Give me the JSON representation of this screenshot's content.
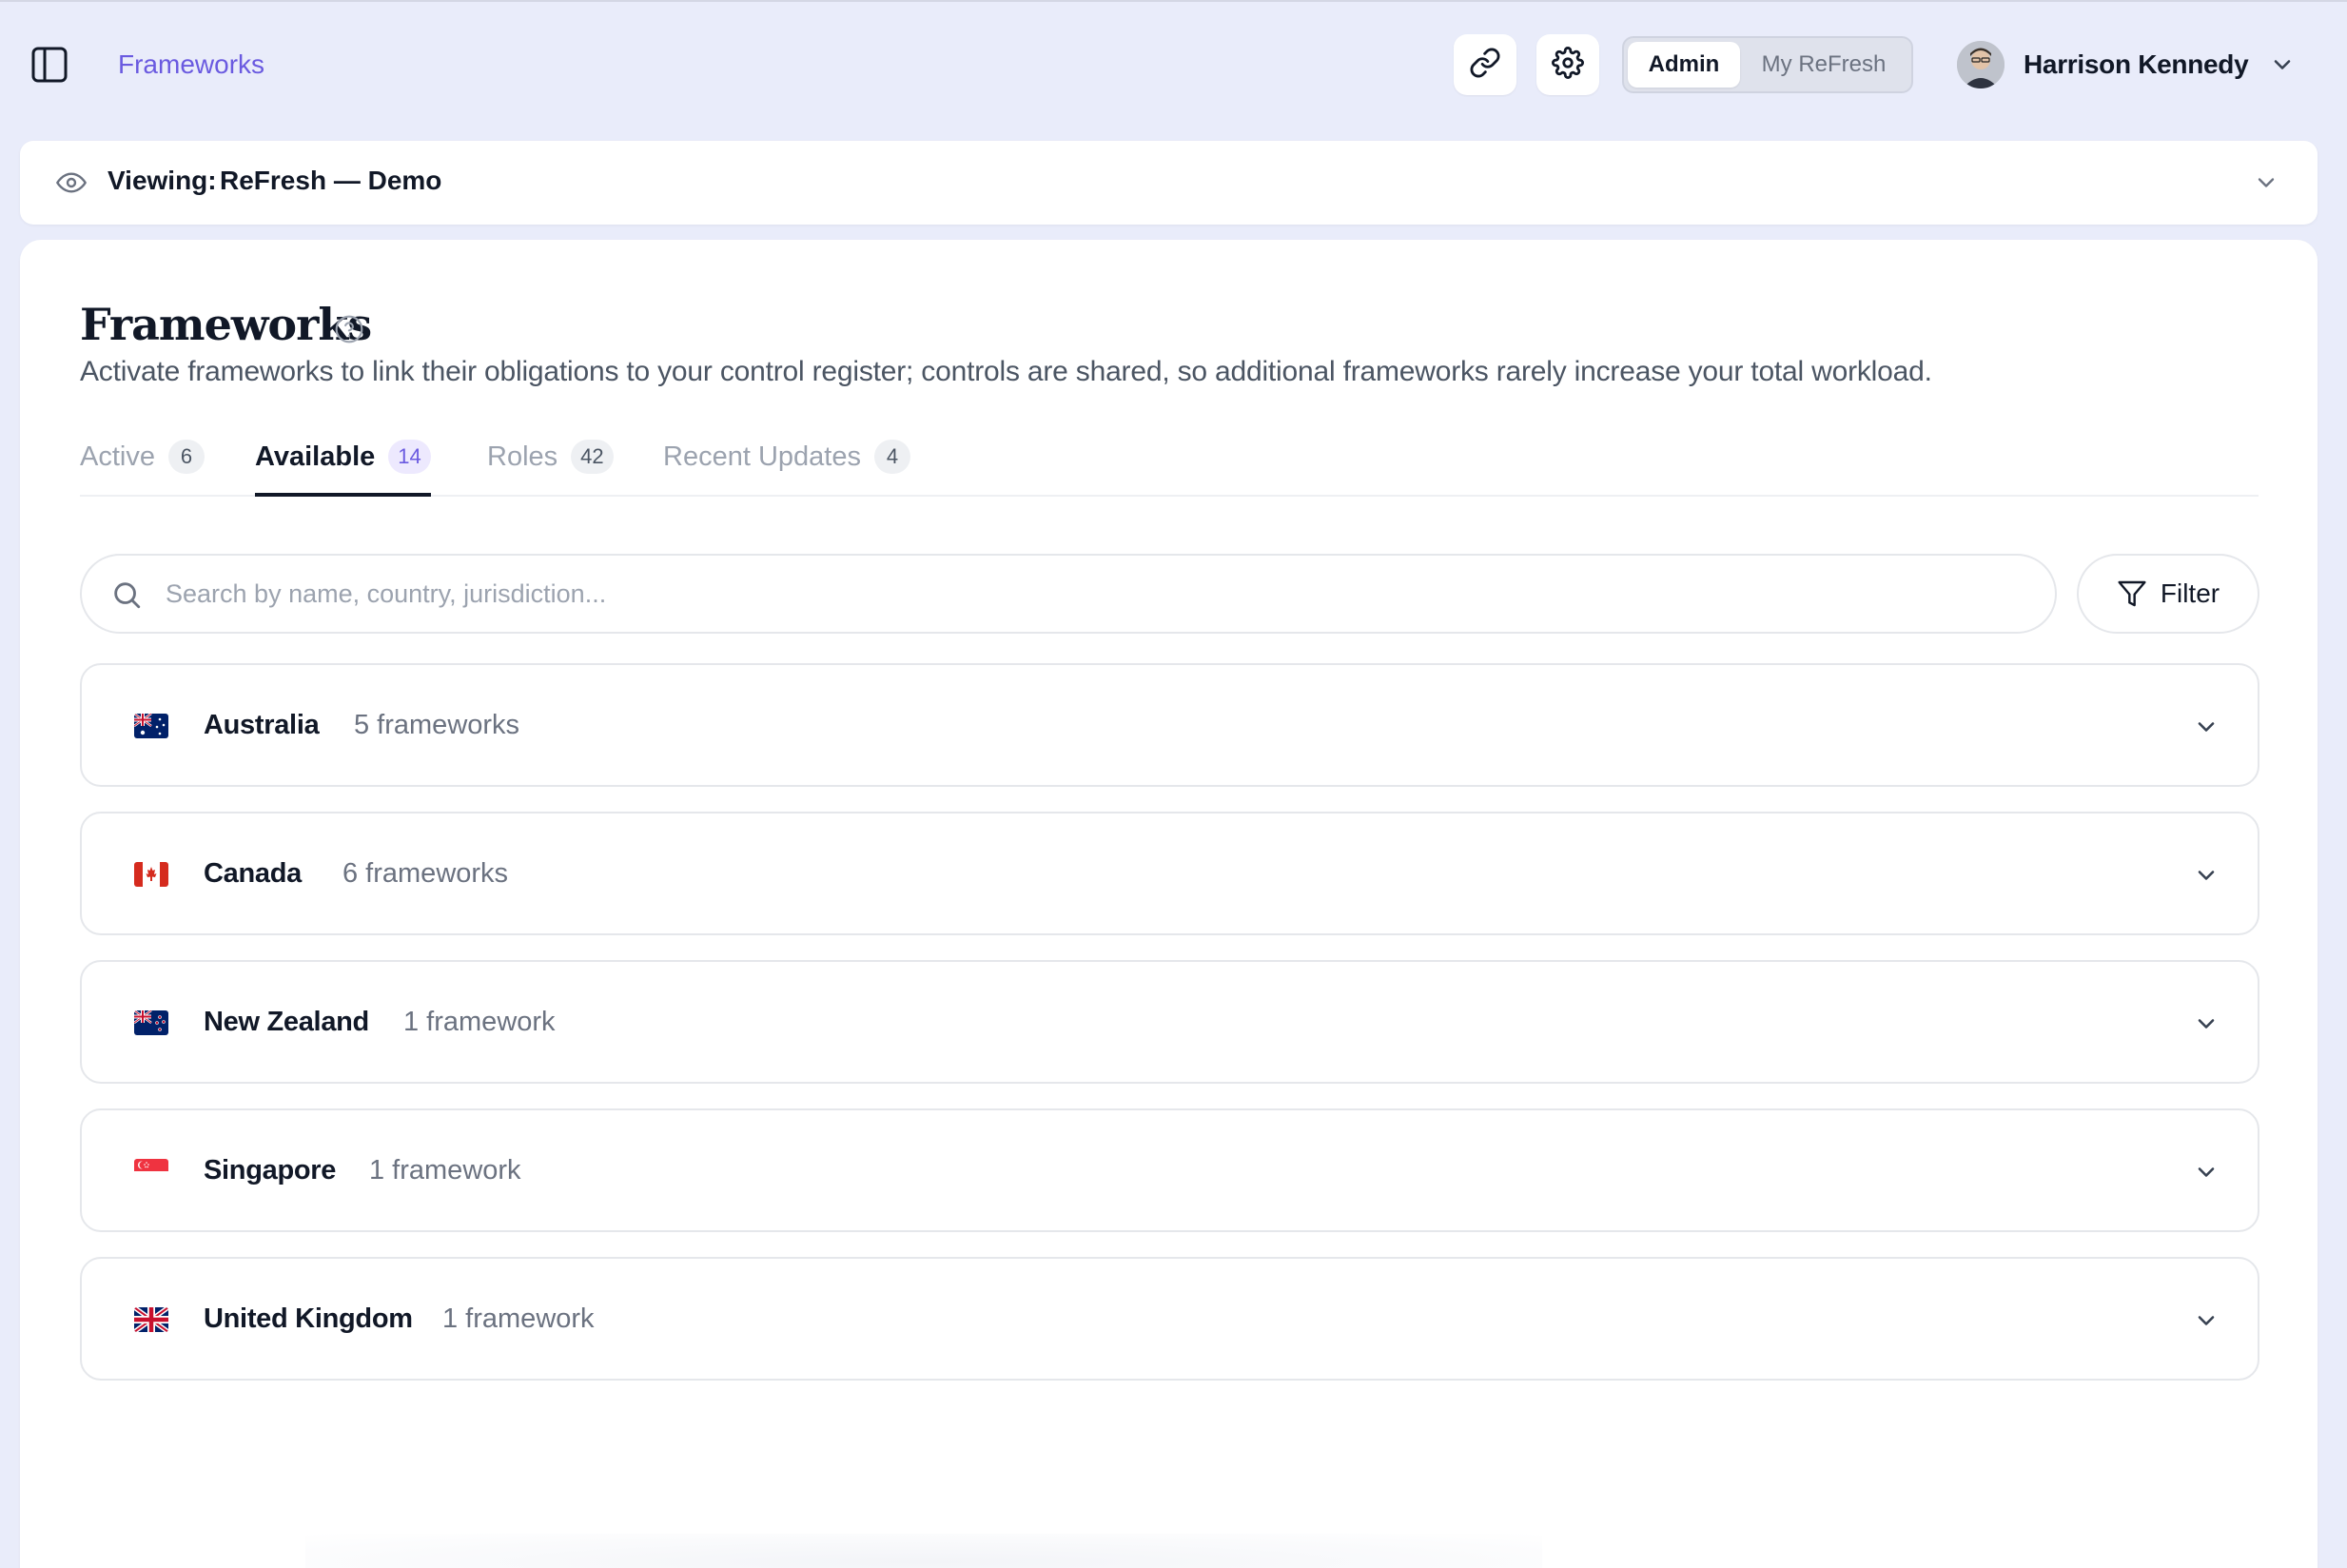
{
  "topbar": {
    "breadcrumb": "Frameworks",
    "mode_toggle": {
      "options": [
        "Admin",
        "My ReFresh"
      ],
      "selected": "Admin"
    },
    "user": {
      "name": "Harrison Kennedy"
    }
  },
  "viewing": {
    "label": "Viewing:",
    "value": "ReFresh — Demo"
  },
  "page": {
    "title": "Frameworks",
    "subtitle": "Activate frameworks to link their obligations to your control register; controls are shared, so additional frameworks rarely increase your total workload."
  },
  "tabs": [
    {
      "label": "Active",
      "count": "6"
    },
    {
      "label": "Available",
      "count": "14",
      "active": true
    },
    {
      "label": "Roles",
      "count": "42"
    },
    {
      "label": "Recent Updates",
      "count": "4"
    }
  ],
  "search": {
    "placeholder": "Search by name, country, jurisdiction...",
    "value": ""
  },
  "filter": {
    "label": "Filter"
  },
  "countries": [
    {
      "name": "Australia",
      "count": "5 frameworks",
      "flag": "australia-flag-icon"
    },
    {
      "name": "Canada",
      "count": "6 frameworks",
      "flag": "canada-flag-icon"
    },
    {
      "name": "New Zealand",
      "count": "1 framework",
      "flag": "new-zealand-flag-icon"
    },
    {
      "name": "Singapore",
      "count": "1 framework",
      "flag": "singapore-flag-icon"
    },
    {
      "name": "United Kingdom",
      "count": "1 framework",
      "flag": "united-kingdom-flag-icon"
    }
  ],
  "colors": {
    "accent": "#6a5ae0",
    "background": "#e9ecfa",
    "text": "#111827",
    "muted": "#6b7280"
  }
}
